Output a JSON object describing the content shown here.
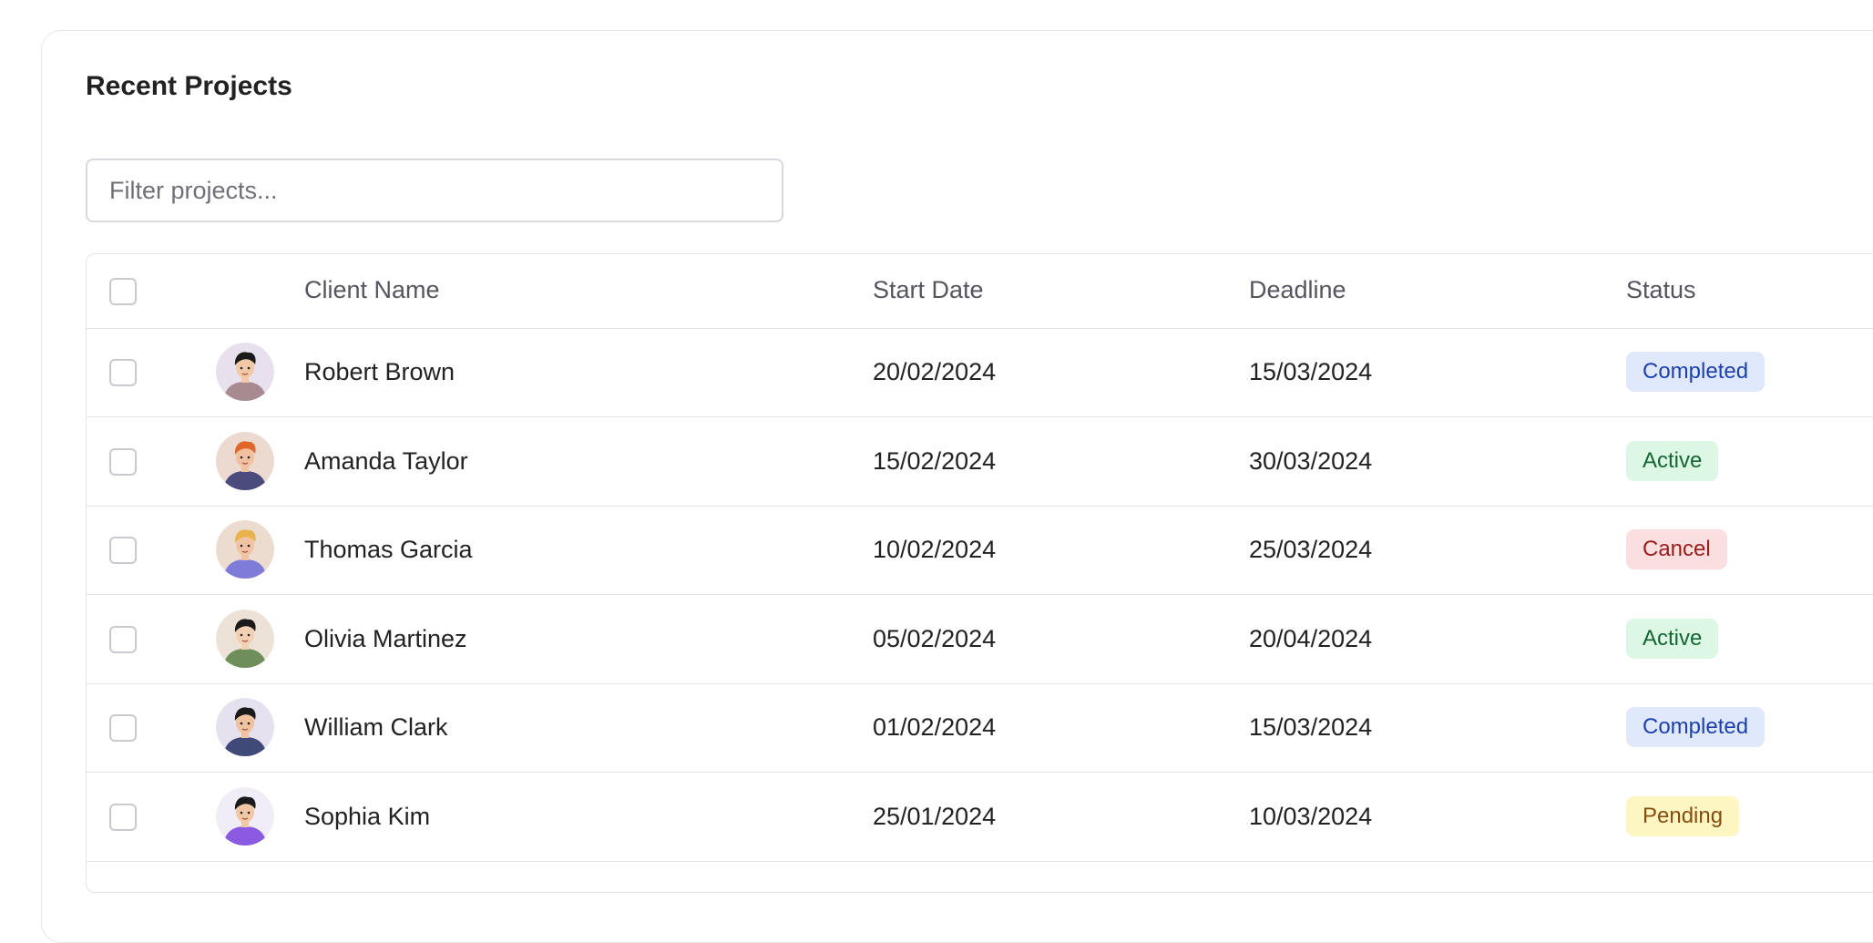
{
  "card": {
    "title": "Recent Projects",
    "filter_placeholder": "Filter projects..."
  },
  "table": {
    "headers": {
      "client_name": "Client Name",
      "start_date": "Start Date",
      "deadline": "Deadline",
      "status": "Status"
    },
    "rows": [
      {
        "name": "Robert Brown",
        "start": "20/02/2024",
        "deadline": "15/03/2024",
        "status": "Completed",
        "avatar_icon": "avatar-robert-brown-icon"
      },
      {
        "name": "Amanda Taylor",
        "start": "15/02/2024",
        "deadline": "30/03/2024",
        "status": "Active",
        "avatar_icon": "avatar-amanda-taylor-icon"
      },
      {
        "name": "Thomas Garcia",
        "start": "10/02/2024",
        "deadline": "25/03/2024",
        "status": "Cancel",
        "avatar_icon": "avatar-thomas-garcia-icon"
      },
      {
        "name": "Olivia Martinez",
        "start": "05/02/2024",
        "deadline": "20/04/2024",
        "status": "Active",
        "avatar_icon": "avatar-olivia-martinez-icon"
      },
      {
        "name": "William Clark",
        "start": "01/02/2024",
        "deadline": "15/03/2024",
        "status": "Completed",
        "avatar_icon": "avatar-william-clark-icon"
      },
      {
        "name": "Sophia Kim",
        "start": "25/01/2024",
        "deadline": "10/03/2024",
        "status": "Pending",
        "avatar_icon": "avatar-sophia-kim-icon"
      }
    ]
  },
  "status_colors": {
    "Completed": {
      "bg": "#dfe9fb",
      "fg": "#1e40af"
    },
    "Active": {
      "bg": "#dcf7e3",
      "fg": "#166534"
    },
    "Cancel": {
      "bg": "#fbdfe0",
      "fg": "#991b1b"
    },
    "Pending": {
      "bg": "#fdf6c3",
      "fg": "#854d0e"
    }
  },
  "avatar_colors": [
    {
      "bg": "#e9e0ee",
      "shirt": "#a88a91",
      "hair": "#1a1a1a",
      "skin": "#f2c9a6"
    },
    {
      "bg": "#ecd9cf",
      "shirt": "#4a4c7e",
      "hair": "#e2672a",
      "skin": "#f1c0a0"
    },
    {
      "bg": "#ecdccf",
      "shirt": "#7f7bd8",
      "hair": "#e8b34a",
      "skin": "#f1c3a3"
    },
    {
      "bg": "#ede2d8",
      "shirt": "#6f8f5a",
      "hair": "#1a1a1a",
      "skin": "#f4d0b2"
    },
    {
      "bg": "#e5e1ee",
      "shirt": "#3f4a78",
      "hair": "#1a1a1a",
      "skin": "#f0c29f"
    },
    {
      "bg": "#f0edf6",
      "shirt": "#8a5ae0",
      "hair": "#1a1a1a",
      "skin": "#f2c7a4"
    }
  ]
}
